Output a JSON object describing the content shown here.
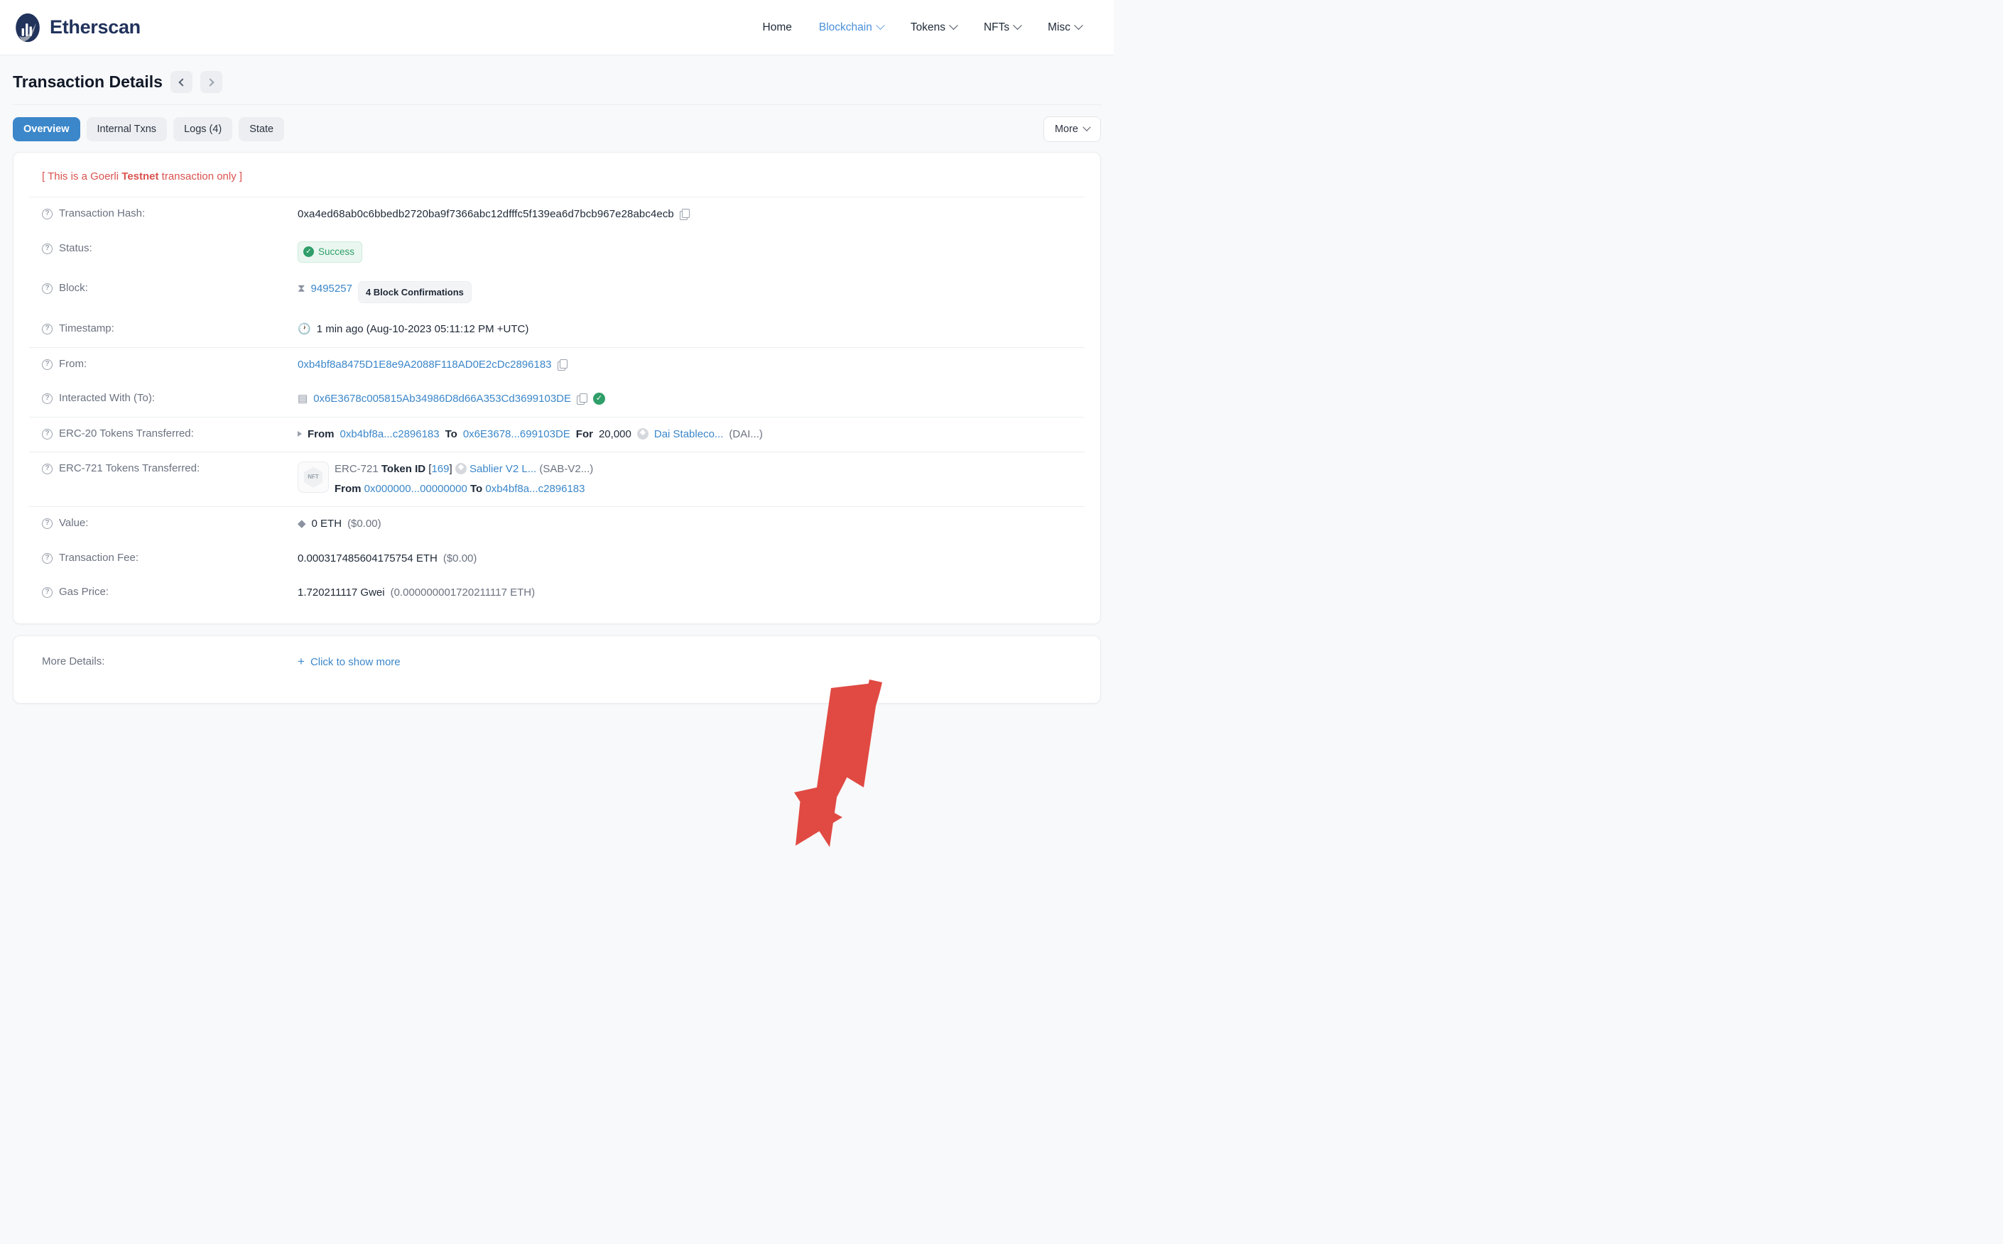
{
  "header": {
    "brand": "Etherscan",
    "nav": [
      {
        "label": "Home",
        "has_caret": false,
        "active": false
      },
      {
        "label": "Blockchain",
        "has_caret": true,
        "active": true
      },
      {
        "label": "Tokens",
        "has_caret": true,
        "active": false
      },
      {
        "label": "NFTs",
        "has_caret": true,
        "active": false
      },
      {
        "label": "Misc",
        "has_caret": true,
        "active": false
      }
    ]
  },
  "page": {
    "title": "Transaction Details",
    "prev_icon": "chevron-left-icon",
    "next_icon": "chevron-right-icon"
  },
  "tabs": [
    {
      "label": "Overview",
      "active": true
    },
    {
      "label": "Internal Txns",
      "active": false
    },
    {
      "label": "Logs (4)",
      "active": false
    },
    {
      "label": "State",
      "active": false
    }
  ],
  "more_button": "More",
  "testnet_notice": {
    "prefix": "[ This is a Goerli ",
    "bold": "Testnet",
    "suffix": " transaction only ]"
  },
  "rows": {
    "tx_hash_label": "Transaction Hash:",
    "tx_hash_value": "0xa4ed68ab0c6bbedb2720ba9f7366abc12dfffc5f139ea6d7bcb967e28abc4ecb",
    "status_label": "Status:",
    "status_value": "Success",
    "block_label": "Block:",
    "block_value": "9495257",
    "block_confirmations": "4 Block Confirmations",
    "timestamp_label": "Timestamp:",
    "timestamp_value": "1 min ago (Aug-10-2023 05:11:12 PM +UTC)",
    "from_label": "From:",
    "from_value": "0xb4bf8a8475D1E8e9A2088F118AD0E2cDc2896183",
    "to_label": "Interacted With (To):",
    "to_value": "0x6E3678c005815Ab34986D8d66A353Cd3699103DE",
    "erc20_label": "ERC-20 Tokens Transferred:",
    "erc20": {
      "from_word": "From",
      "from_addr": "0xb4bf8a...c2896183",
      "to_word": "To",
      "to_addr": "0x6E3678...699103DE",
      "for_word": "For",
      "amount": "20,000",
      "token_name": "Dai Stableco...",
      "token_symbol": "(DAI...)"
    },
    "erc721_label": "ERC-721 Tokens Transferred:",
    "erc721": {
      "standard": "ERC-721",
      "token_id_word": "Token ID",
      "token_id": "169",
      "collection": "Sablier V2 L...",
      "symbol": "(SAB-V2...)",
      "from_word": "From",
      "from_addr": "0x000000...00000000",
      "to_word": "To",
      "to_addr": "0xb4bf8a...c2896183",
      "thumb_label": "NFT"
    },
    "value_label": "Value:",
    "value_value": "0 ETH",
    "value_fiat": "($0.00)",
    "fee_label": "Transaction Fee:",
    "fee_value": "0.000317485604175754 ETH",
    "fee_fiat": "($0.00)",
    "gas_label": "Gas Price:",
    "gas_value": "1.720211117 Gwei",
    "gas_eth": "(0.000000001720211117 ETH)"
  },
  "more_details": {
    "label": "More Details:",
    "link": "Click to show more",
    "plus": "+"
  },
  "colors": {
    "accent_blue": "#3b87ca",
    "link_blue": "#3b87ca",
    "brand_navy": "#21325b",
    "danger_red": "#d9534f",
    "success_green": "#2f9e68",
    "annotation_red": "#e04a43"
  }
}
